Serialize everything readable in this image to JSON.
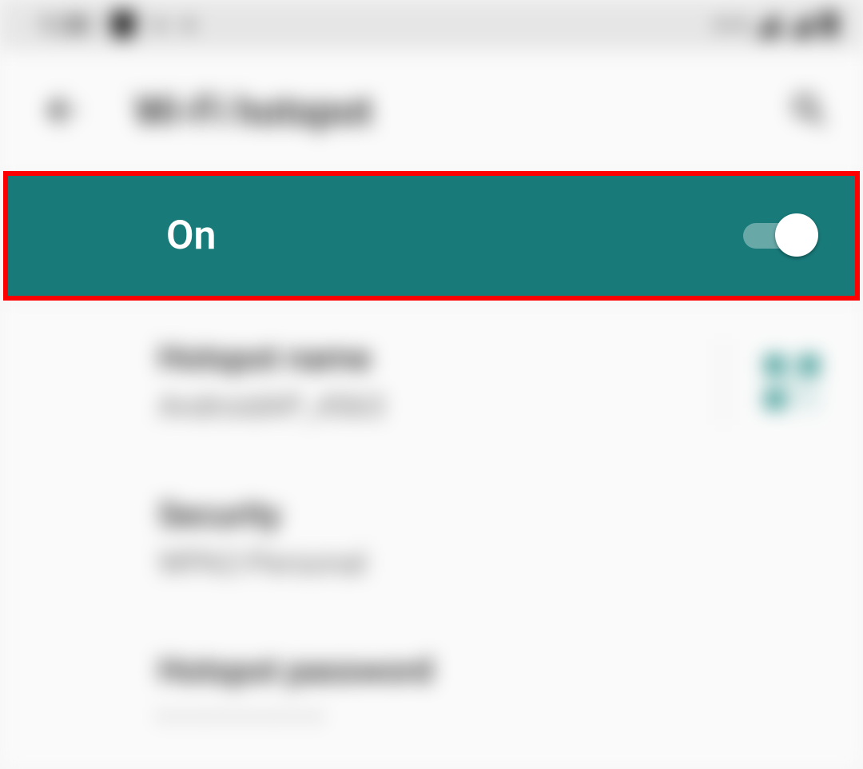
{
  "status": {
    "time": "1:30"
  },
  "header": {
    "title": "Wi-Fi hotspot"
  },
  "toggle": {
    "status_label": "On",
    "state": "on"
  },
  "settings": {
    "hotspot_name": {
      "label": "Hotspot name",
      "value": "AndroidAP_4563"
    },
    "security": {
      "label": "Security",
      "value": "WPA2-Personal"
    },
    "hotspot_password": {
      "label": "Hotspot password",
      "value_masked": "••••••••••"
    }
  },
  "colors": {
    "accent": "#187b7a",
    "highlight_border": "#ff0000"
  }
}
